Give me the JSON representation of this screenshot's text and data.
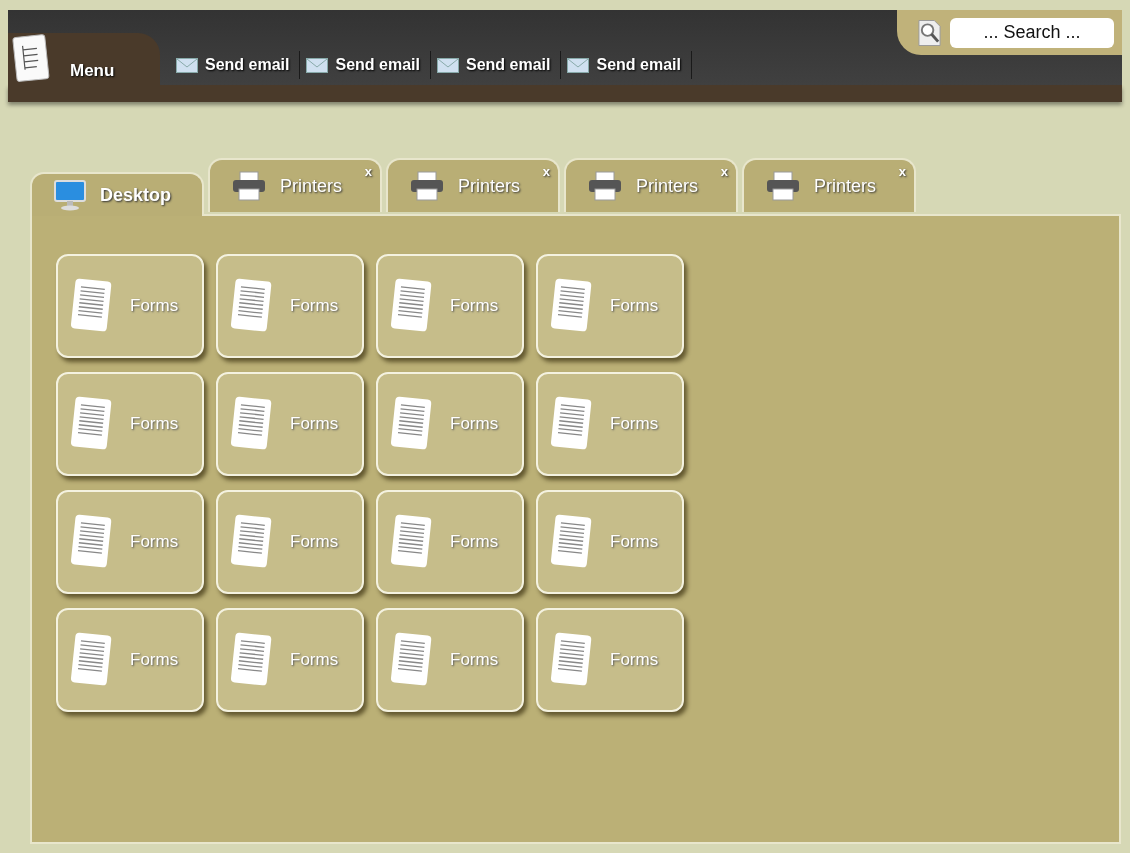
{
  "menu": {
    "label": "Menu"
  },
  "toolbar": [
    {
      "label": "Send email"
    },
    {
      "label": "Send email"
    },
    {
      "label": "Send email"
    },
    {
      "label": "Send email"
    }
  ],
  "search": {
    "placeholder": "... Search ..."
  },
  "tabs": [
    {
      "label": "Desktop",
      "kind": "desktop",
      "selected": true
    },
    {
      "label": "Printers",
      "kind": "printer",
      "selected": false,
      "close": "x"
    },
    {
      "label": "Printers",
      "kind": "printer",
      "selected": false,
      "close": "x"
    },
    {
      "label": "Printers",
      "kind": "printer",
      "selected": false,
      "close": "x"
    },
    {
      "label": "Printers",
      "kind": "printer",
      "selected": false,
      "close": "x"
    }
  ],
  "tiles": [
    {
      "label": "Forms"
    },
    {
      "label": "Forms"
    },
    {
      "label": "Forms"
    },
    {
      "label": "Forms"
    },
    {
      "label": "Forms"
    },
    {
      "label": "Forms"
    },
    {
      "label": "Forms"
    },
    {
      "label": "Forms"
    },
    {
      "label": "Forms"
    },
    {
      "label": "Forms"
    },
    {
      "label": "Forms"
    },
    {
      "label": "Forms"
    },
    {
      "label": "Forms"
    },
    {
      "label": "Forms"
    },
    {
      "label": "Forms"
    },
    {
      "label": "Forms"
    }
  ]
}
